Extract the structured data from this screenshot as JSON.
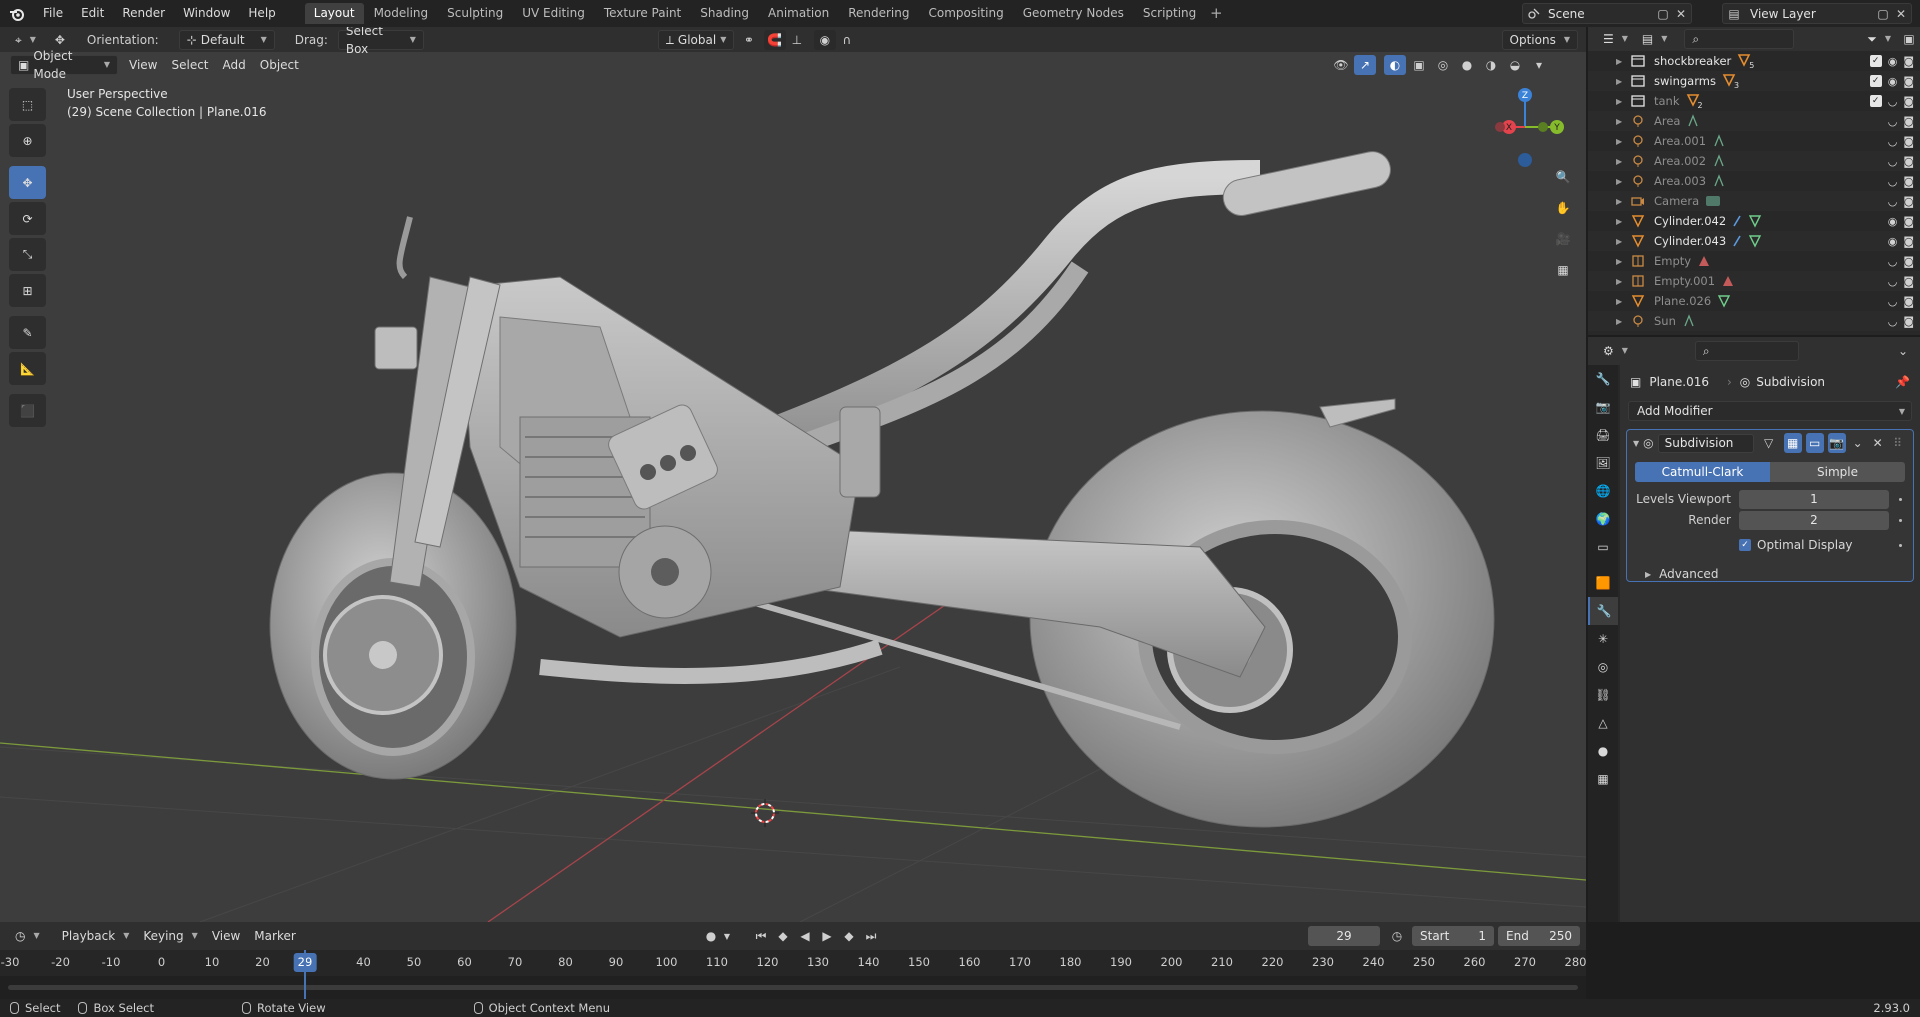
{
  "app": {
    "menu": [
      "File",
      "Edit",
      "Render",
      "Window",
      "Help"
    ],
    "workspaces": [
      "Layout",
      "Modeling",
      "Sculpting",
      "UV Editing",
      "Texture Paint",
      "Shading",
      "Animation",
      "Rendering",
      "Compositing",
      "Geometry Nodes",
      "Scripting"
    ],
    "active_workspace": "Layout",
    "scene": "Scene",
    "view_layer": "View Layer",
    "version": "2.93.0"
  },
  "viewport": {
    "orientation_label": "Orientation:",
    "orientation_value": "Default",
    "drag_label": "Drag:",
    "drag_value": "Select Box",
    "transform_orientation": "Global",
    "options_label": "Options",
    "mode": "Object Mode",
    "menus": [
      "View",
      "Select",
      "Add",
      "Object"
    ],
    "info_line1": "User Perspective",
    "info_line2": "(29) Scene Collection | Plane.016",
    "gizmo_axes": [
      "X",
      "Y",
      "Z"
    ]
  },
  "outliner": {
    "rows": [
      {
        "name": "shockbreaker",
        "kind": "collection",
        "badge": "5",
        "dim": false,
        "checked": true
      },
      {
        "name": "swingarms",
        "kind": "collection",
        "badge": "3",
        "dim": false,
        "checked": true
      },
      {
        "name": "tank",
        "kind": "collection",
        "badge": "2",
        "dim": true,
        "checked": true
      },
      {
        "name": "Area",
        "kind": "light",
        "dim": true
      },
      {
        "name": "Area.001",
        "kind": "light",
        "dim": true
      },
      {
        "name": "Area.002",
        "kind": "light",
        "dim": true
      },
      {
        "name": "Area.003",
        "kind": "light",
        "dim": true
      },
      {
        "name": "Camera",
        "kind": "camera",
        "dim": true
      },
      {
        "name": "Cylinder.042",
        "kind": "mesh",
        "dim": false
      },
      {
        "name": "Cylinder.043",
        "kind": "mesh",
        "dim": false
      },
      {
        "name": "Empty",
        "kind": "empty",
        "dim": true
      },
      {
        "name": "Empty.001",
        "kind": "empty",
        "dim": true
      },
      {
        "name": "Plane.026",
        "kind": "mesh",
        "dim": true
      },
      {
        "name": "Sun",
        "kind": "light",
        "dim": true
      }
    ]
  },
  "properties": {
    "object_name": "Plane.016",
    "modifier_crumb": "Subdivision",
    "add_modifier": "Add Modifier",
    "modifier": {
      "name": "Subdivision",
      "mode_on": "Catmull-Clark",
      "mode_off": "Simple",
      "levels_viewport_label": "Levels Viewport",
      "levels_viewport": "1",
      "render_label": "Render",
      "render": "2",
      "optimal_display": "Optimal Display",
      "optimal_display_checked": true,
      "advanced": "Advanced"
    }
  },
  "timeline": {
    "menus": [
      "Playback",
      "Keying",
      "View",
      "Marker"
    ],
    "current_frame": "29",
    "start_label": "Start",
    "start": "1",
    "end_label": "End",
    "end": "250",
    "ticks": [
      "-30",
      "-20",
      "-10",
      "0",
      "10",
      "20",
      "29",
      "40",
      "50",
      "60",
      "70",
      "80",
      "90",
      "100",
      "110",
      "120",
      "130",
      "140",
      "150",
      "160",
      "170",
      "180",
      "190",
      "200",
      "210",
      "220",
      "230",
      "240",
      "250",
      "260",
      "270",
      "280"
    ]
  },
  "statusbar": {
    "select": "Select",
    "box_select": "Box Select",
    "rotate_view": "Rotate View",
    "context_menu": "Object Context Menu"
  },
  "colors": {
    "accent": "#4772b3",
    "x_axis": "#e2434c",
    "y_axis": "#86bc2b",
    "z_axis": "#3b83d8",
    "collection_icon": "#e48d2f"
  }
}
